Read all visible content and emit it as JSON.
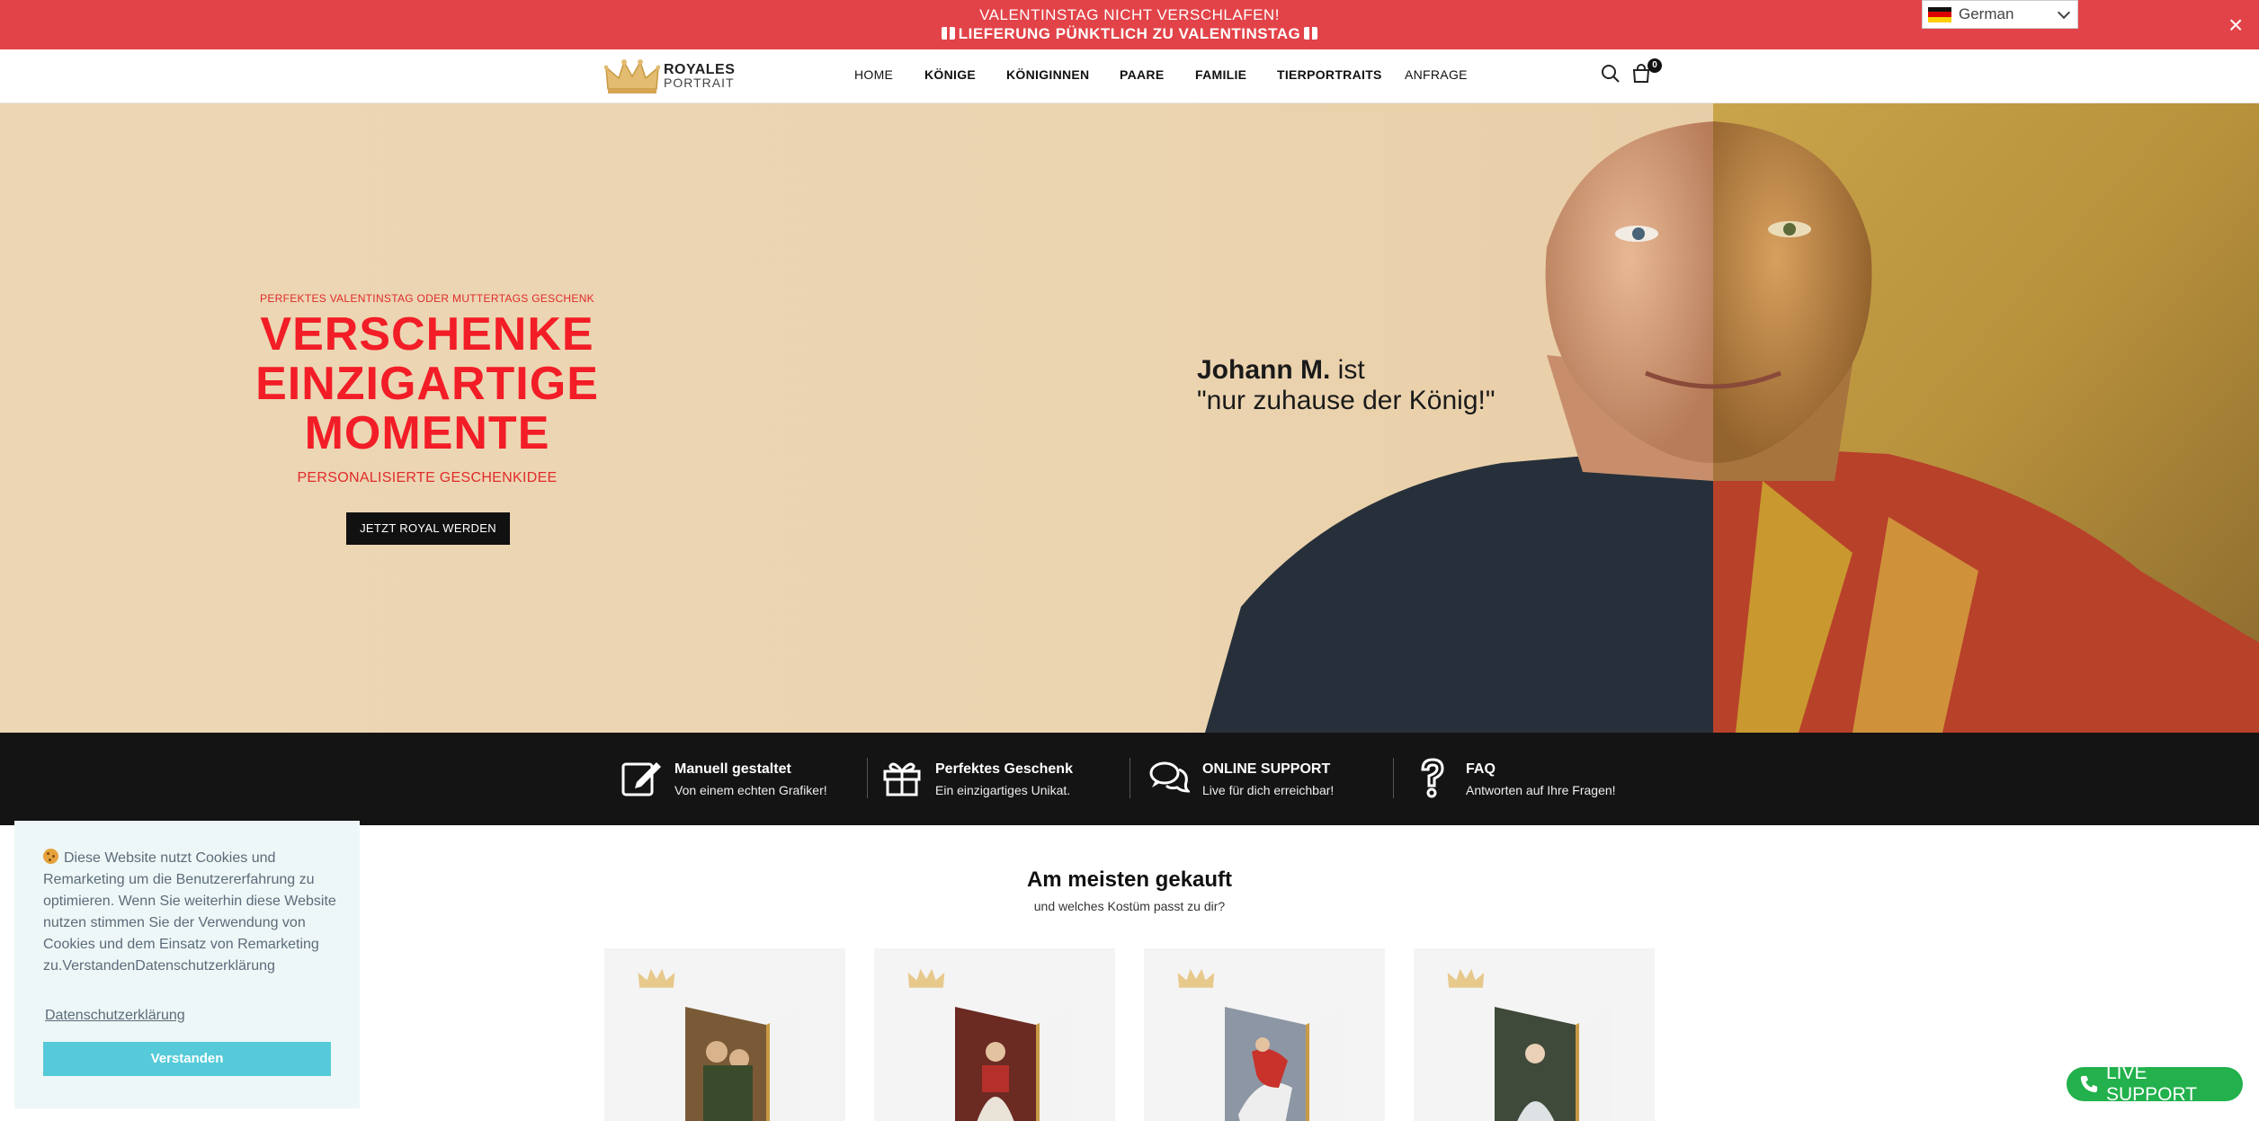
{
  "announcement": {
    "line1": "VALENTINSTAG NICHT VERSCHLAFEN!",
    "line2": "LIEFERUNG PÜNKTLICH ZU VALENTINSTAG",
    "language": "German",
    "close": "×"
  },
  "header": {
    "logo_line1": "ROYALES",
    "logo_line2": "PORTRAIT",
    "nav": [
      "HOME",
      "KÖNIGE",
      "KÖNIGINNEN",
      "PAARE",
      "FAMILIE",
      "TIERPORTRAITS",
      "ANFRAGE"
    ],
    "cart_count": "0"
  },
  "hero": {
    "kicker": "PERFEKTES VALENTINSTAG ODER MUTTERTAGS GESCHENK",
    "title_line1": "VERSCHENKE",
    "title_line2": "EINZIGARTIGE",
    "title_line3": "MOMENTE",
    "subtitle": "PERSONALISIERTE GESCHENKIDEE",
    "button": "JETZT ROYAL WERDEN",
    "quote_name": "Johann M.",
    "quote_rest": " ist",
    "quote_line2": "\"nur zuhause der König!\""
  },
  "features": [
    {
      "title": "Manuell gestaltet",
      "subtitle": "Von einem echten Grafiker!",
      "icon": "edit-icon"
    },
    {
      "title": "Perfektes Geschenk",
      "subtitle": "Ein einzigartiges Unikat.",
      "icon": "gift-icon"
    },
    {
      "title": "ONLINE SUPPORT",
      "subtitle": "Live für dich erreichbar!",
      "icon": "chat-icon"
    },
    {
      "title": "FAQ",
      "subtitle": "Antworten auf Ihre Fragen!",
      "icon": "question-icon"
    }
  ],
  "products": {
    "title": "Am meisten gekauft",
    "subtitle": "und welches Kostüm passt zu dir?"
  },
  "cookie": {
    "text": "Diese Website nutzt Cookies und Remarketing um die Benutzererfahrung zu optimieren. Wenn Sie weiterhin diese Website nutzen stimmen Sie der Verwendung von Cookies und dem Einsatz von Remarketing zu.VerstandenDatenschutzerklärung",
    "link": "Datenschutzerklärung",
    "button": "Verstanden"
  },
  "live_support": "LIVE SUPPORT",
  "colors": {
    "announcement_bg": "#e24348",
    "hero_title": "#f21d26",
    "feature_bg": "#141414",
    "cookie_button": "#56cad8",
    "live_support_bg": "#22b14c"
  }
}
